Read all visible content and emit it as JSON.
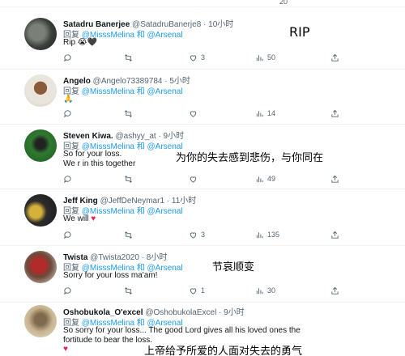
{
  "top_partial": {
    "count": "20"
  },
  "tweets": [
    {
      "name": "Satadru Banerjee",
      "handle": "@SatadruBanerje8",
      "time": "· 10小时",
      "reply_prefix": "回复",
      "mention1": "@MisssMelina",
      "and": "和",
      "mention2": "@Arsenal",
      "text": "Rip 😭🖤",
      "replies": "",
      "retweets": "",
      "likes": "3",
      "views": "50"
    },
    {
      "name": "Angelo",
      "handle": "@Angelo73389784",
      "time": "· 5小时",
      "reply_prefix": "回复",
      "mention1": "@MisssMelina",
      "and": "和",
      "mention2": "@Arsenal",
      "text": "🙏",
      "replies": "",
      "retweets": "",
      "likes": "",
      "views": "14"
    },
    {
      "name": "Steven Kiwa.",
      "handle": "@ashyy_at",
      "time": "· 9小时",
      "reply_prefix": "回复",
      "mention1": "@MisssMelina",
      "and": "和",
      "mention2": "@Arsenal",
      "text_line1": "So for your loss.",
      "text_line2": "We r in this together",
      "replies": "",
      "retweets": "",
      "likes": "",
      "views": "49"
    },
    {
      "name": "Jeff King",
      "handle": "@JeffDeNeymar1",
      "time": "· 11小时",
      "reply_prefix": "回复",
      "mention1": "@MisssMelina",
      "and": "和",
      "mention2": "@Arsenal",
      "text": "We will",
      "text_emoji": "♥",
      "replies": "",
      "retweets": "",
      "likes": "3",
      "views": "135"
    },
    {
      "name": "Twista",
      "handle": "@Twista2020",
      "time": "· 8小时",
      "reply_prefix": "回复",
      "mention1": "@MisssMelina",
      "and": "和",
      "mention2": "@Arsenal",
      "text": "Sorry for your loss ma'am!",
      "replies": "",
      "retweets": "",
      "likes": "1",
      "views": "30"
    },
    {
      "name": "Oshobukola_O'excel",
      "handle": "@OshobukolaExcel",
      "time": "· 9小时",
      "reply_prefix": "回复",
      "mention1": "@MisssMelina",
      "and": "和",
      "mention2": "@Arsenal",
      "text_line1": "So sorry for your loss... The good Lord gives all his loved ones the",
      "text_line2": "fortitude to bear the loss.",
      "text_emoji": "♥"
    }
  ],
  "overlays": {
    "rip": "RIP",
    "cn1": "为你的失去感到悲伤，与你同在",
    "cn2": "节哀顺变",
    "cn3": "上帝给予所爱的人面对失去的勇气"
  },
  "colors": {
    "accent": "#1d9bf0",
    "text_secondary": "#536471",
    "heart": "#e0245e"
  },
  "icons": [
    "reply-icon",
    "retweet-icon",
    "like-icon",
    "views-icon",
    "share-icon"
  ]
}
